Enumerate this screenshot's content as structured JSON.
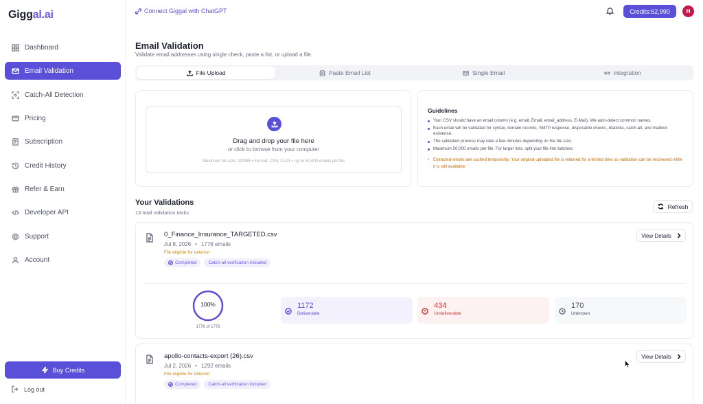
{
  "brand": {
    "logo_main": "Gigg",
    "logo_accent": "al.ai"
  },
  "sidebar": {
    "items": [
      {
        "label": "Dashboard",
        "icon": "grid-icon"
      },
      {
        "label": "Email Validation",
        "icon": "mail-icon",
        "active": true
      },
      {
        "label": "Catch-All Detection",
        "icon": "scan-icon"
      },
      {
        "label": "Pricing",
        "icon": "card-icon"
      },
      {
        "label": "Subscription",
        "icon": "receipt-icon"
      },
      {
        "label": "Credit History",
        "icon": "history-icon"
      },
      {
        "label": "Refer & Earn",
        "icon": "gift-icon"
      },
      {
        "label": "Developer API",
        "icon": "code-icon"
      },
      {
        "label": "Support",
        "icon": "lifebuoy-icon"
      },
      {
        "label": "Account",
        "icon": "user-icon"
      }
    ],
    "buy_credits": "Buy Credits",
    "logout": "Log out"
  },
  "header": {
    "connect": "Connect Giggal with ChatGPT",
    "credits": "Credits:62,990",
    "avatar_initial": "H"
  },
  "page": {
    "title": "Email Validation",
    "subtitle": "Validate email addresses using single check, paste a list, or upload a file."
  },
  "tabs": [
    {
      "label": "File Upload",
      "active": true
    },
    {
      "label": "Paste Email List"
    },
    {
      "label": "Single Email"
    },
    {
      "label": "Integration"
    }
  ],
  "upload": {
    "title": "Drag and drop your file here",
    "subtitle": "or click to browse from your computer",
    "note": "Maximum file size: 200MB • Format: CSV, XLSX • Up to 50,000 emails per file"
  },
  "guidelines": {
    "title": "Guidelines",
    "items": [
      "Your CSV should have an email column (e.g. email, Email, email_address, E-Mail). We auto-detect common names.",
      "Each email will be validated for syntax, domain records, SMTP response, disposable checks, blacklist, catch-all, and mailbox existence.",
      "The validation process may take a few minutes depending on the file size.",
      "Maximum 50,000 emails per file. For larger lists, split your file into batches."
    ],
    "warning": "Extracted emails are cached temporarily. Your original uploaded file is retained for a limited time so validation can be recovered while it is still available."
  },
  "validations": {
    "title": "Your Validations",
    "subtitle": "13 total validation tasks",
    "refresh": "Refresh",
    "view_details": "View Details",
    "tasks": [
      {
        "file": "0_Finance_Insurance_TARGETED.csv",
        "date": "Jul 8, 2026",
        "emails": "1776 emails",
        "eligible": "File eligible for deletion",
        "status": "Completed",
        "catchall": "Catch-all verification included",
        "progress_label": "100%",
        "progress_fraction": 1.0,
        "progress_sub": "1776 of 1776",
        "deliverable": {
          "value": "1172",
          "label": "Deliverable"
        },
        "undeliverable": {
          "value": "434",
          "label": "Undeliverable"
        },
        "unknown": {
          "value": "170",
          "label": "Unknown"
        }
      },
      {
        "file": "apollo-contacts-export (26).csv",
        "date": "Jul 2, 2026",
        "emails": "1292 emails",
        "eligible": "File eligible for deletion",
        "status": "Completed",
        "catchall": "Catch-all verification included"
      }
    ]
  },
  "colors": {
    "accent": "#5a4fd8",
    "danger": "#d03a3a",
    "warning": "#d4870a"
  }
}
